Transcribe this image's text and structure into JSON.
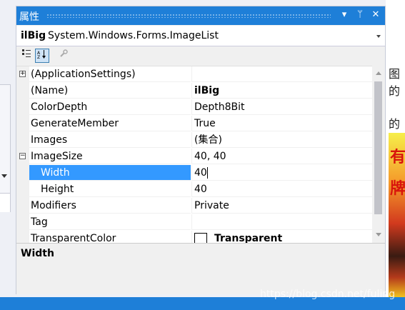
{
  "window": {
    "title": "属性",
    "buttons": {
      "dropdown": "▾",
      "pin": "ᛘ",
      "close": "✕"
    }
  },
  "object_selector": {
    "name": "ilBig",
    "type": "System.Windows.Forms.ImageList"
  },
  "toolbar": {
    "categorized_icon": "categorized-icon",
    "alphabetical_icon": "alphabetical-icon",
    "property_pages_icon": "wrench-icon"
  },
  "properties": [
    {
      "name": "(ApplicationSettings)",
      "value": "",
      "expander": "+",
      "bold": false
    },
    {
      "name": "(Name)",
      "value": "ilBig",
      "bold": true
    },
    {
      "name": "ColorDepth",
      "value": "Depth8Bit"
    },
    {
      "name": "GenerateMember",
      "value": "True"
    },
    {
      "name": "Images",
      "value": "(集合)"
    },
    {
      "name": "ImageSize",
      "value": "40, 40",
      "expander": "−"
    },
    {
      "name": "Width",
      "value": "40",
      "child": true,
      "selected": true
    },
    {
      "name": "Height",
      "value": "40",
      "child": true
    },
    {
      "name": "Modifiers",
      "value": "Private"
    },
    {
      "name": "Tag",
      "value": ""
    },
    {
      "name": "TransparentColor",
      "value": "Transparent",
      "bold": true,
      "swatch": true
    }
  ],
  "description": {
    "title": "Width"
  },
  "background": {
    "right_glyphs": [
      "图的",
      "的"
    ],
    "image_chars": [
      "有",
      "牌"
    ],
    "watermark": "https://blog.csdn.net/fuling"
  },
  "colors": {
    "accent": "#1e7fd8",
    "selection": "#3399ff"
  }
}
